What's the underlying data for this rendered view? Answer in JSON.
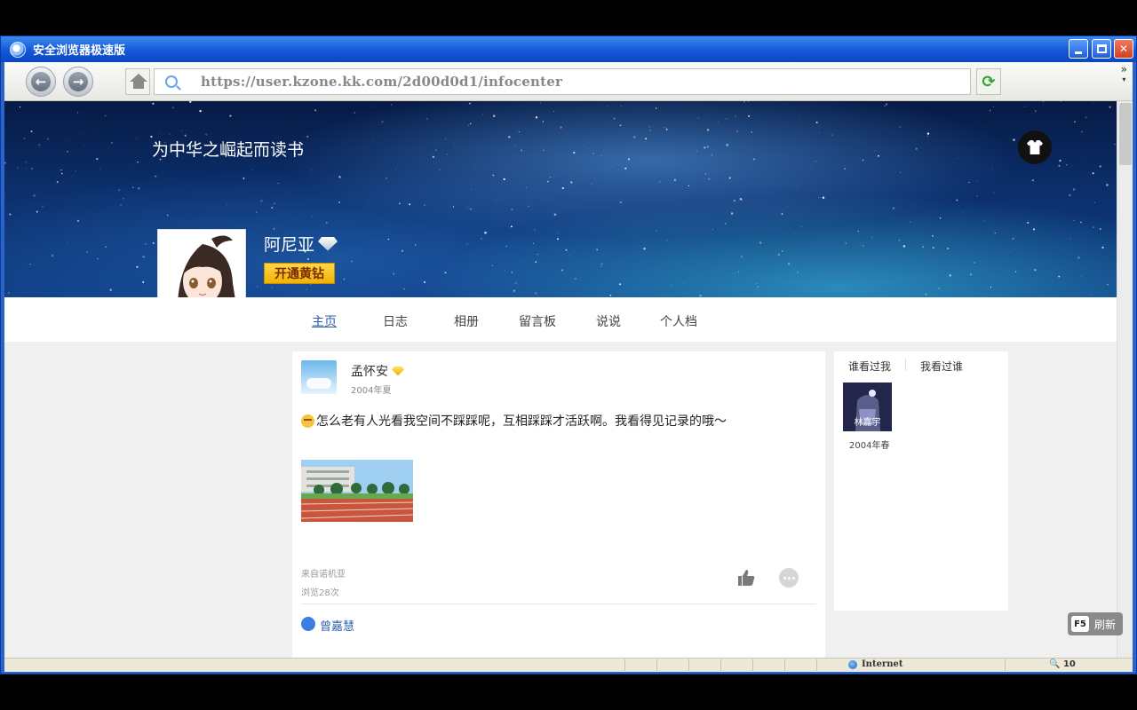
{
  "window": {
    "title": "安全浏览器极速版"
  },
  "toolbar": {
    "url": "https://user.kzone.kk.com/2d00d0d1/infocenter",
    "more": "»"
  },
  "profile": {
    "motto": "为中华之崛起而读书",
    "name": "阿尼亚",
    "vip_label": "开通黄钻"
  },
  "nav": {
    "tabs": [
      "主页",
      "日志",
      "相册",
      "留言板",
      "说说",
      "个人档"
    ],
    "active": 0
  },
  "post": {
    "author": "孟怀安",
    "date": "2004年夏",
    "text": "怎么老有人光看我空间不踩踩呢，互相踩踩才活跃啊。我看得见记录的哦～",
    "source": "来自诺机亚",
    "views": "浏览28次",
    "liker": "曾嘉慧"
  },
  "visitors": {
    "tab_who_visited": "谁看过我",
    "tab_i_visited": "我看过谁",
    "items": [
      {
        "name": "林嘉宇",
        "date": "2004年春"
      }
    ]
  },
  "status": {
    "zone": "Internet",
    "zoom": "10",
    "refresh_key": "F5",
    "refresh_label": "刷新"
  }
}
